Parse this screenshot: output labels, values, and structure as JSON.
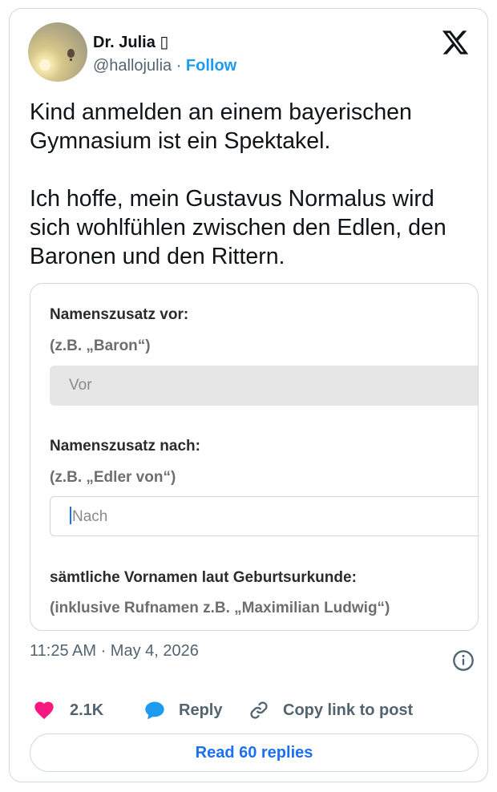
{
  "author": {
    "name": "Dr. Julia ▯",
    "handle": "@hallojulia",
    "separator": " · ",
    "follow_label": "Follow"
  },
  "tweet": {
    "text": "Kind anmelden an einem bayerischen Gymnasium ist ein Spektakel.\n\nIch hoffe, mein Gustavus Normalus wird sich wohlfühlen zwischen den Edlen, den Baronen und den Rittern."
  },
  "form_image": {
    "prefix_label": "Namenszusatz vor:",
    "prefix_hint": "(z.B. „Baron“)",
    "prefix_placeholder": "Vor",
    "suffix_label": "Namenszusatz nach:",
    "suffix_hint": "(z.B. „Edler von“)",
    "suffix_placeholder": "Nach",
    "firstnames_label": "sämtliche Vornamen laut Geburtsurkunde:",
    "firstnames_hint": "(inklusive Rufnamen z.B. „Maximilian Ludwig“)"
  },
  "meta": {
    "timestamp": "11:25 AM · May 4, 2026"
  },
  "actions": {
    "like_count": "2.1K",
    "reply_label": "Reply",
    "copy_label": "Copy link to post"
  },
  "read_replies_label": "Read 60 replies",
  "icons": {
    "platform": "x-logo-icon",
    "info": "info-icon",
    "like": "heart-icon",
    "reply": "reply-bubble-icon",
    "copy": "link-icon"
  },
  "colors": {
    "accent": "#1d9bf0",
    "like": "#f91880",
    "text": "#0f1419",
    "secondary": "#536471",
    "border": "#cfd9de"
  }
}
